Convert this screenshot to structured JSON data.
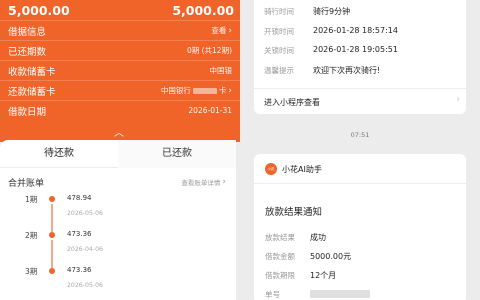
{
  "loan": {
    "amount_left": "5,000.00",
    "amount_right": "5,000.00",
    "rows": [
      {
        "label": "借据信息",
        "value": "查看"
      },
      {
        "label": "已还期数",
        "value": "0期 (共12期)"
      },
      {
        "label": "收款储蓄卡",
        "value": "中国银"
      },
      {
        "label": "还款储蓄卡",
        "value": "中国银行",
        "suffix": "卡"
      },
      {
        "label": "借款日期",
        "value": "2026-01-31"
      }
    ]
  },
  "tabs": {
    "pending": "待还款",
    "repaid": "已还款"
  },
  "bills": {
    "merge_label": "合并账单",
    "details_link": "查看账单详情",
    "items": [
      {
        "period": "1期",
        "amount": "478.94",
        "date": "2026-05-06"
      },
      {
        "period": "2期",
        "amount": "473.36",
        "date": "2026-04-06"
      },
      {
        "period": "3期",
        "amount": "473.36",
        "date": "2026-05-06"
      }
    ]
  },
  "ride": {
    "rows": [
      {
        "key": "骑行时间",
        "value": "骑行9分钟"
      },
      {
        "key": "开锁时间",
        "value": "2026-01-28 18:57:14"
      },
      {
        "key": "关锁时间",
        "value": "2026-01-28 19:05:51"
      },
      {
        "key": "温馨提示",
        "value": "欢迎下次再次骑行!"
      }
    ],
    "miniprogram": "进入小程序查看"
  },
  "chat_time": "07:51",
  "notice": {
    "logo_text": "小花",
    "source": "小花AI助手",
    "title": "放款结果通知",
    "rows": [
      {
        "key": "放款结果",
        "value": "成功"
      },
      {
        "key": "借款金额",
        "value": "5000.00元"
      },
      {
        "key": "借款期限",
        "value": "12个月"
      },
      {
        "key": "单号",
        "value": ""
      }
    ]
  },
  "colors": {
    "brand": "#f0642a",
    "timeline_line": "#f4a98a"
  }
}
